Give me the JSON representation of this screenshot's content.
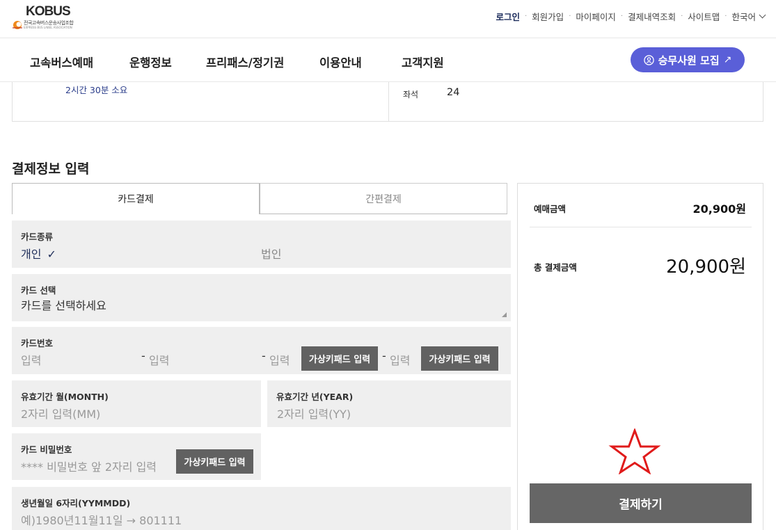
{
  "header": {
    "logo_text": "KOBUS",
    "logo_subtitle": "전국고속버스운송사업조합",
    "logo_subtitle_en": "EXPRESS BUS LABEL ASSOCIATION",
    "util_links": [
      "로그인",
      "회원가입",
      "마이페이지",
      "결제내역조회",
      "사이트맵",
      "한국어"
    ]
  },
  "nav": {
    "items": [
      "고속버스예매",
      "운행정보",
      "프리패스/정기권",
      "이용안내",
      "고객지원"
    ],
    "recruit_label": "승무사원 모집",
    "recruit_arrow": "↗"
  },
  "summary": {
    "duration": "2시간 30분 소요",
    "seat_label": "좌석",
    "seat_value": "24"
  },
  "payment": {
    "section_title": "결제정보 입력",
    "tabs": [
      "카드결제",
      "간편결제"
    ],
    "card_type": {
      "label": "카드종류",
      "options": [
        "개인",
        "법인"
      ],
      "selected_mark": "✓"
    },
    "card_select": {
      "label": "카드 선택",
      "value": "카드를 선택하세요"
    },
    "card_number": {
      "label": "카드번호",
      "placeholder": "입력",
      "virtual_keypad": "가상키패드 입력"
    },
    "expiry_month": {
      "label": "유효기간 월(MONTH)",
      "placeholder": "2자리 입력(MM)"
    },
    "expiry_year": {
      "label": "유효기간 년(YEAR)",
      "placeholder": "2자리 입력(YY)"
    },
    "card_password": {
      "label": "카드 비밀번호",
      "placeholder": "**** 비밀번호 앞 2자리 입력",
      "virtual_keypad": "가상키패드 입력"
    },
    "birth": {
      "label": "생년월일 6자리(YYMMDD)",
      "placeholder": "예)1980년11월11일 → 801111"
    }
  },
  "price": {
    "booking_label": "예매금액",
    "booking_value": "20,900원",
    "total_label": "총 결제금액",
    "total_value": "20,900원",
    "pay_button": "결제하기"
  },
  "colors": {
    "accent": "#5a5fd8",
    "button_gray": "#666666",
    "field_bg": "#efefef",
    "star": "#e01b1b"
  }
}
